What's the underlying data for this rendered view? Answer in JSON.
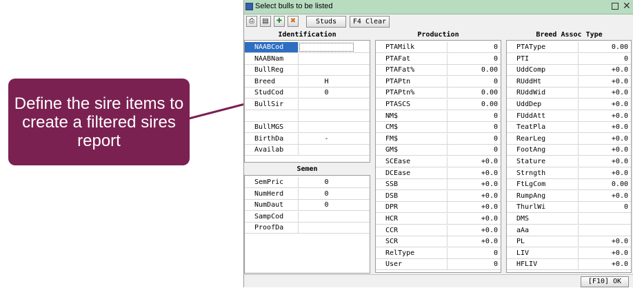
{
  "callout": {
    "text": "Define the sire items to create a filtered sires report"
  },
  "window": {
    "title": "Select bulls to be listed"
  },
  "toolbar": {
    "icons": [
      "print-icon",
      "copy-icon",
      "add-green-icon",
      "remove-orange-icon"
    ],
    "studs_label": "Studs",
    "clear_label": "F4 Clear"
  },
  "identification": {
    "header": "Identification",
    "rows": [
      {
        "label": "NAABCod",
        "value": ""
      },
      {
        "label": "NAABNam",
        "value": ""
      },
      {
        "label": "BullReg",
        "value": ""
      },
      {
        "label": "Breed",
        "value": "H"
      },
      {
        "label": "StudCod",
        "value": "0"
      },
      {
        "label": "BullSir",
        "value": ""
      },
      {
        "label": "",
        "value": ""
      },
      {
        "label": "BullMGS",
        "value": ""
      },
      {
        "label": "BirthDa",
        "value": "-"
      },
      {
        "label": "Availab",
        "value": ""
      }
    ]
  },
  "semen": {
    "header": "Semen",
    "rows": [
      {
        "label": "SemPric",
        "value": "0"
      },
      {
        "label": "NumHerd",
        "value": "0"
      },
      {
        "label": "NumDaut",
        "value": "0"
      },
      {
        "label": "SampCod",
        "value": ""
      },
      {
        "label": "ProofDa",
        "value": ""
      }
    ]
  },
  "production": {
    "header": "Production",
    "rows": [
      {
        "label": "PTAMilk",
        "value": "0"
      },
      {
        "label": "PTAFat",
        "value": "0"
      },
      {
        "label": "PTAFat%",
        "value": "0.00"
      },
      {
        "label": "PTAPtn",
        "value": "0"
      },
      {
        "label": "PTAPtn%",
        "value": "0.00"
      },
      {
        "label": "PTASCS",
        "value": "0.00"
      },
      {
        "label": "NM$",
        "value": "0"
      },
      {
        "label": "CM$",
        "value": "0"
      },
      {
        "label": "FM$",
        "value": "0"
      },
      {
        "label": "GM$",
        "value": "0"
      },
      {
        "label": "SCEase",
        "value": "+0.0"
      },
      {
        "label": "DCEase",
        "value": "+0.0"
      },
      {
        "label": "SSB",
        "value": "+0.0"
      },
      {
        "label": "DSB",
        "value": "+0.0"
      },
      {
        "label": "DPR",
        "value": "+0.0"
      },
      {
        "label": "HCR",
        "value": "+0.0"
      },
      {
        "label": "CCR",
        "value": "+0.0"
      },
      {
        "label": "SCR",
        "value": "+0.0"
      },
      {
        "label": "RelType",
        "value": "0"
      },
      {
        "label": "User",
        "value": "0"
      }
    ]
  },
  "breed": {
    "header": "Breed Assoc Type",
    "rows": [
      {
        "label": "PTAType",
        "value": "0.00"
      },
      {
        "label": "PTI",
        "value": "0"
      },
      {
        "label": "UddComp",
        "value": "+0.0"
      },
      {
        "label": "RUddHt",
        "value": "+0.0"
      },
      {
        "label": "RUddWid",
        "value": "+0.0"
      },
      {
        "label": "UddDep",
        "value": "+0.0"
      },
      {
        "label": "FUddAtt",
        "value": "+0.0"
      },
      {
        "label": "TeatPla",
        "value": "+0.0"
      },
      {
        "label": "RearLeg",
        "value": "+0.0"
      },
      {
        "label": "FootAng",
        "value": "+0.0"
      },
      {
        "label": "Stature",
        "value": "+0.0"
      },
      {
        "label": "Strngth",
        "value": "+0.0"
      },
      {
        "label": "FtLgCom",
        "value": "0.00"
      },
      {
        "label": "RumpAng",
        "value": "+0.0"
      },
      {
        "label": "ThurlWi",
        "value": "0"
      },
      {
        "label": "DMS",
        "value": ""
      },
      {
        "label": "aAa",
        "value": ""
      },
      {
        "label": "PL",
        "value": "+0.0"
      },
      {
        "label": "LIV",
        "value": "+0.0"
      },
      {
        "label": "HFLIV",
        "value": "+0.0"
      }
    ]
  },
  "footer": {
    "ok_label": "[F10] OK"
  }
}
